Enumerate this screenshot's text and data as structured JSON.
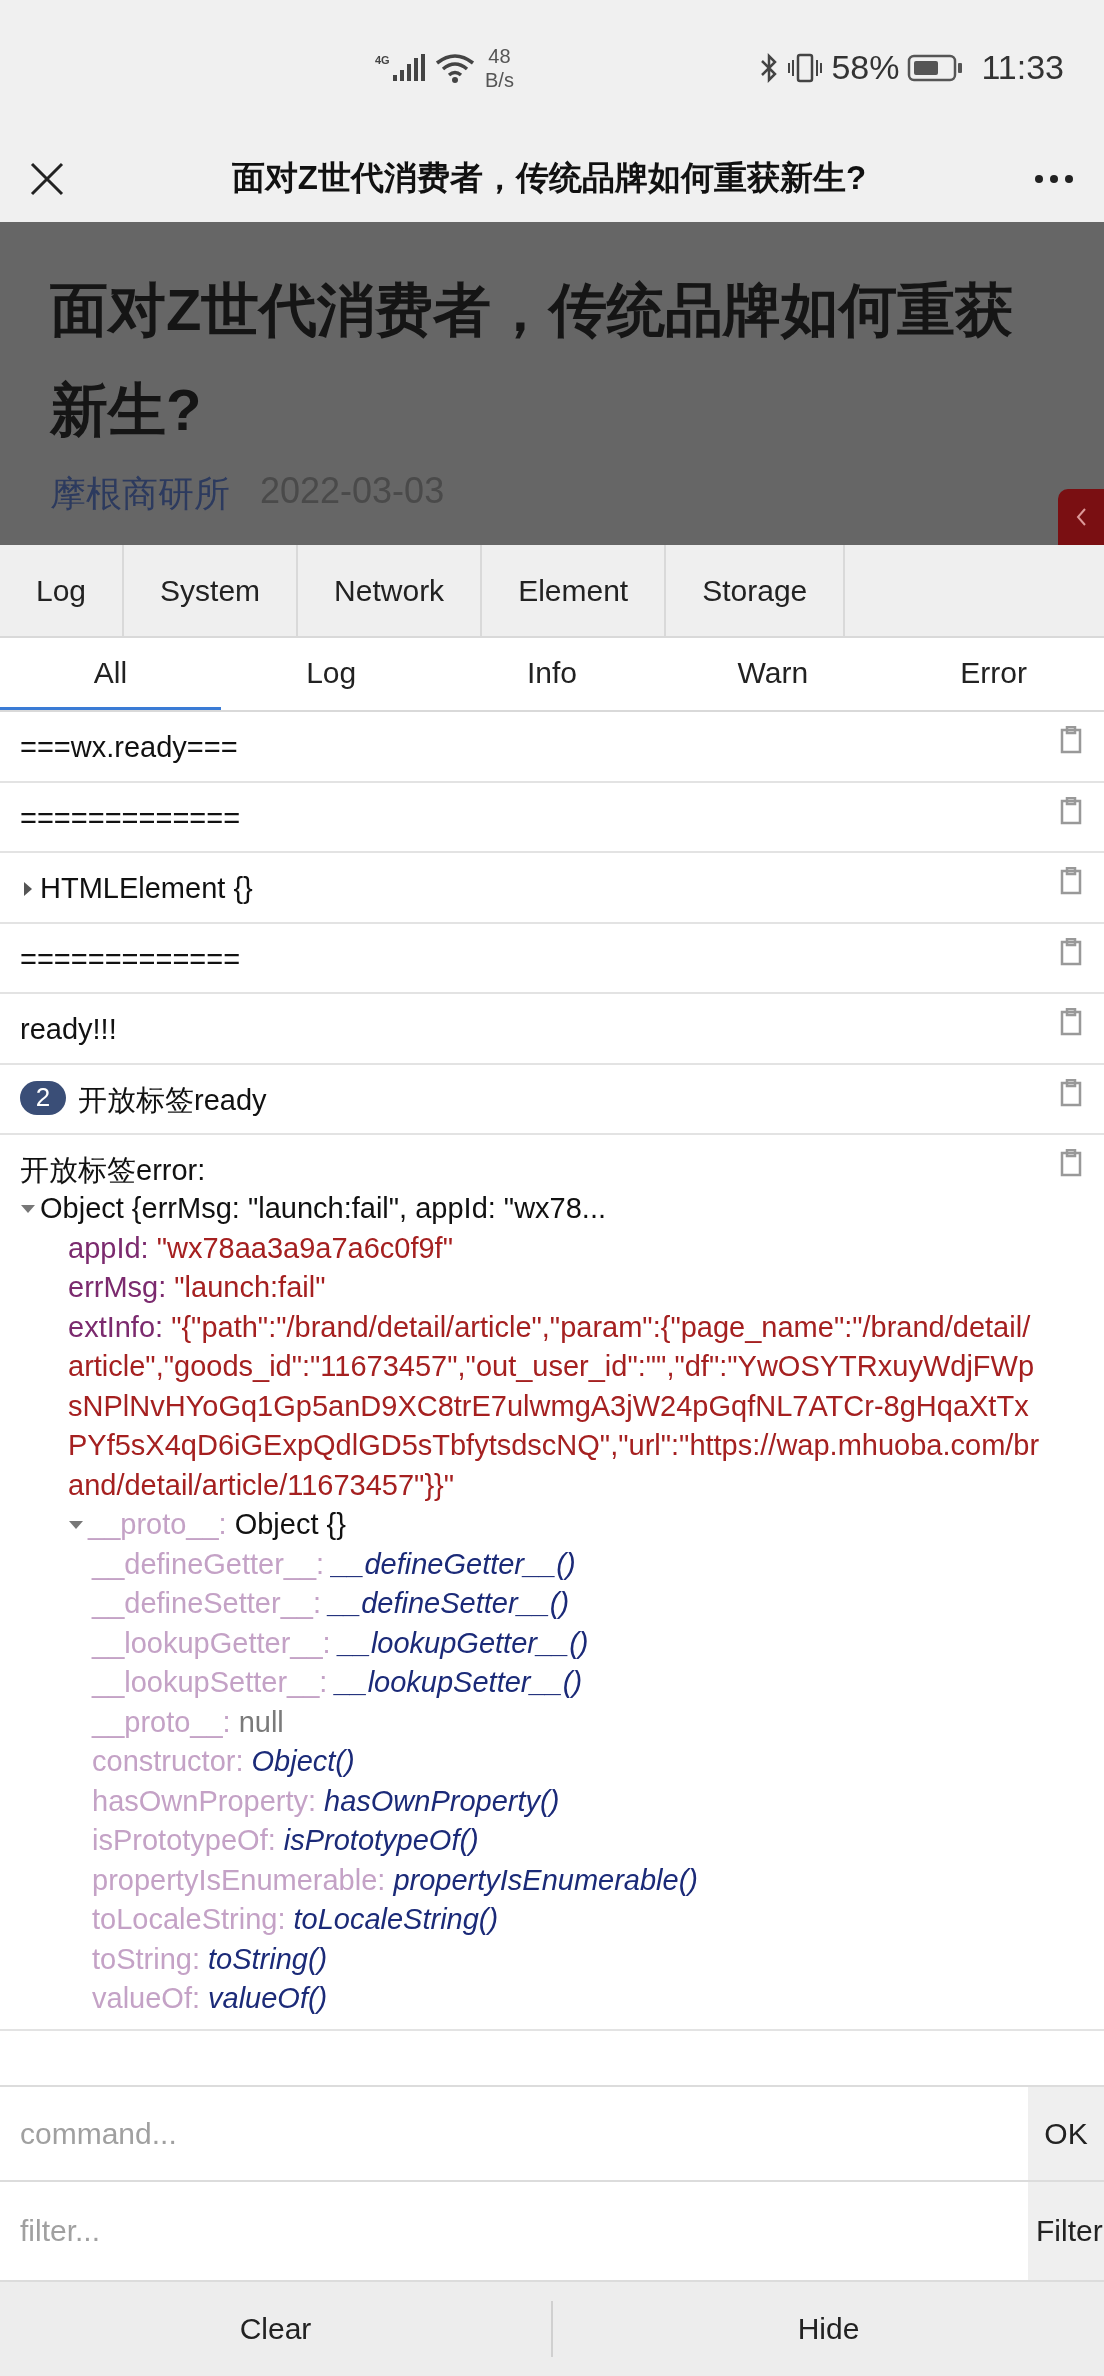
{
  "status_bar": {
    "network_type": "4G",
    "speed": "48",
    "speed_unit": "B/s",
    "battery": "58%",
    "time": "11:33"
  },
  "nav_bar": {
    "title": "面对Z世代消费者，传统品牌如何重获新生?"
  },
  "article": {
    "title": "面对Z世代消费者，传统品牌如何重获新生?",
    "author": "摩根商研所",
    "date": "2022-03-03"
  },
  "devtools": {
    "tabs": [
      {
        "label": "Log"
      },
      {
        "label": "System"
      },
      {
        "label": "Network"
      },
      {
        "label": "Element"
      },
      {
        "label": "Storage"
      }
    ],
    "filter_tabs": [
      {
        "label": "All",
        "selected": true
      },
      {
        "label": "Log",
        "selected": false
      },
      {
        "label": "Info",
        "selected": false
      },
      {
        "label": "Warn",
        "selected": false
      },
      {
        "label": "Error",
        "selected": false
      }
    ],
    "logs": [
      {
        "kind": "text",
        "text": "===wx.ready==="
      },
      {
        "kind": "text",
        "text": "============="
      },
      {
        "kind": "object",
        "text": "HTMLElement {}",
        "expanded": false
      },
      {
        "kind": "text",
        "text": "============="
      },
      {
        "kind": "text",
        "text": "ready!!!"
      },
      {
        "kind": "repeat",
        "count": "2",
        "text": "开放标签ready"
      },
      {
        "kind": "tree",
        "text": "开放标签error:",
        "tree": {
          "label": "Object {errMsg: \"launch:fail\", appId: \"wx78...",
          "expanded": true,
          "children": [
            {
              "key": "appId:",
              "value": "\"wx78aa3a9a7a6c0f9f\"",
              "kind": "string",
              "enumerable": true
            },
            {
              "key": "errMsg:",
              "value": "\"launch:fail\"",
              "kind": "string",
              "enumerable": true
            },
            {
              "key": "extInfo:",
              "value": "\"{\"path\":\"/brand/detail/article\",\"param\":{\"page_name\":\"/brand/detail/article\",\"goods_id\":\"11673457\",\"out_user_id\":\"\",\"df\":\"YwOSYTRxuyWdjFWpsNPlNvHYoGq1Gp5anD9XC8trE7ulwmgA3jW24pGqfNL7ATCr-8gHqaXtTxPYf5sX4qD6iGExpQdlGD5sTbfytsdscNQ\",\"url\":\"https://wap.mhuoba.com/brand/detail/article/11673457\"}}\"",
              "kind": "string",
              "enumerable": true
            },
            {
              "key": "__proto__:",
              "value": "Object {}",
              "kind": "object",
              "enumerable": false,
              "expanded": true,
              "children": [
                {
                  "key": "__defineGetter__:",
                  "value": "__defineGetter__()",
                  "kind": "function",
                  "enumerable": false
                },
                {
                  "key": "__defineSetter__:",
                  "value": "__defineSetter__()",
                  "kind": "function",
                  "enumerable": false
                },
                {
                  "key": "__lookupGetter__:",
                  "value": "__lookupGetter__()",
                  "kind": "function",
                  "enumerable": false
                },
                {
                  "key": "__lookupSetter__:",
                  "value": "__lookupSetter__()",
                  "kind": "function",
                  "enumerable": false
                },
                {
                  "key": "__proto__:",
                  "value": "null",
                  "kind": "null",
                  "enumerable": false
                },
                {
                  "key": "constructor:",
                  "value": "Object()",
                  "kind": "function",
                  "enumerable": false
                },
                {
                  "key": "hasOwnProperty:",
                  "value": "hasOwnProperty()",
                  "kind": "function",
                  "enumerable": false
                },
                {
                  "key": "isPrototypeOf:",
                  "value": "isPrototypeOf()",
                  "kind": "function",
                  "enumerable": false
                },
                {
                  "key": "propertyIsEnumerable:",
                  "value": "propertyIsEnumerable()",
                  "kind": "function",
                  "enumerable": false
                },
                {
                  "key": "toLocaleString:",
                  "value": "toLocaleString()",
                  "kind": "function",
                  "enumerable": false
                },
                {
                  "key": "toString:",
                  "value": "toString()",
                  "kind": "function",
                  "enumerable": false
                },
                {
                  "key": "valueOf:",
                  "value": "valueOf()",
                  "kind": "function",
                  "enumerable": false
                }
              ]
            }
          ]
        }
      }
    ],
    "command": {
      "placeholder": "command...",
      "button": "OK"
    },
    "filter": {
      "placeholder": "filter...",
      "button": "Filter"
    },
    "buttons": [
      "Clear",
      "Hide"
    ]
  }
}
